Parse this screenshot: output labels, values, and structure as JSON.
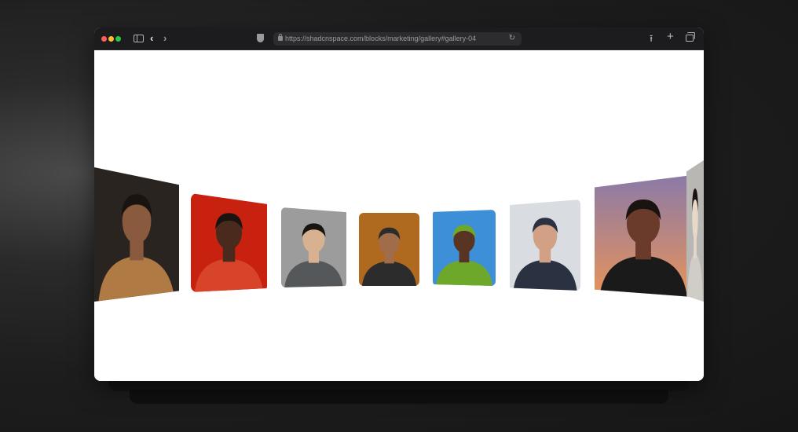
{
  "browser": {
    "url": "https://shadcnspace.com/blocks/marketing/gallery#gallery-04",
    "icons": [
      "sidebar-icon",
      "back-icon",
      "forward-icon",
      "shield-icon",
      "lock-icon",
      "reload-icon",
      "share-icon",
      "plus-icon",
      "tabs-icon"
    ]
  },
  "gallery": {
    "cards": [
      {
        "name": "gallery-card-man-tan-jacket",
        "bg": "#2a2420",
        "skin": "#8a5a3e",
        "accent": "#b07a45"
      },
      {
        "name": "gallery-card-man-red-jacket",
        "bg": "#c8210f",
        "skin": "#4a2a1c",
        "accent": "#d8442a"
      },
      {
        "name": "gallery-card-man-smiling-gray",
        "bg": "#9c9c9c",
        "skin": "#d8b290",
        "accent": "#55585a"
      },
      {
        "name": "gallery-card-man-cap-mustache",
        "bg": "#b06a20",
        "skin": "#a06c4a",
        "accent": "#2c2c2c"
      },
      {
        "name": "gallery-card-woman-green-beanie",
        "bg": "#3d8fd8",
        "skin": "#5a3422",
        "accent": "#6ea82a"
      },
      {
        "name": "gallery-card-man-navy-cap",
        "bg": "#d9dde2",
        "skin": "#d2a084",
        "accent": "#2a3140"
      },
      {
        "name": "gallery-card-woman-sunset",
        "bg": "#e8935a",
        "skin": "#6a3a2a",
        "accent": "#1a1a1a"
      },
      {
        "name": "gallery-card-partial-right",
        "bg": "#b9b7b3",
        "skin": "#e7d8c8",
        "accent": "#d0ccc6"
      }
    ]
  }
}
